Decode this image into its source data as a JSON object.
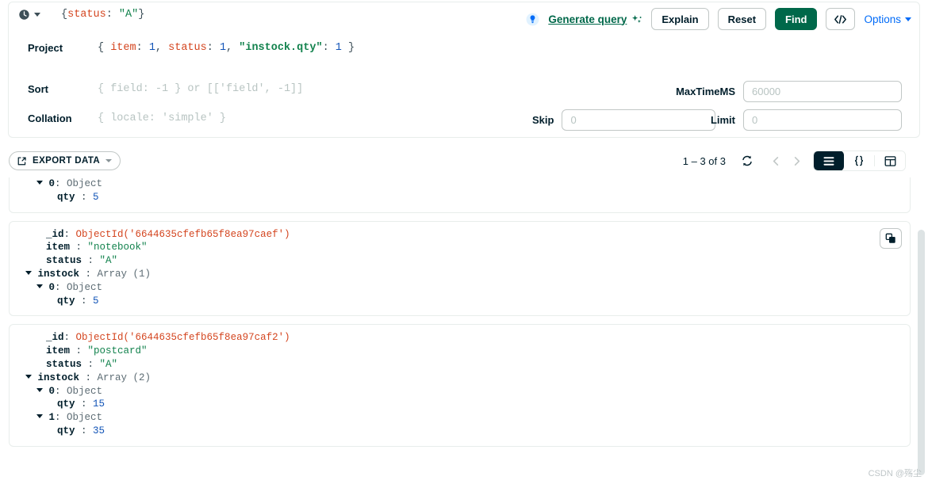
{
  "query_bar": {
    "history_icon": "clock-history-icon",
    "filter": {
      "label": "",
      "segments": [
        {
          "t": "{",
          "c": "punc"
        },
        {
          "t": "status",
          "c": "key"
        },
        {
          "t": ": ",
          "c": "punc"
        },
        {
          "t": "\"A\"",
          "c": "str"
        },
        {
          "t": "}",
          "c": "punc"
        }
      ]
    },
    "project": {
      "label": "Project",
      "segments": [
        {
          "t": "{ ",
          "c": "punc"
        },
        {
          "t": "item",
          "c": "key"
        },
        {
          "t": ": ",
          "c": "punc"
        },
        {
          "t": "1",
          "c": "num"
        },
        {
          "t": ", ",
          "c": "punc"
        },
        {
          "t": "status",
          "c": "key"
        },
        {
          "t": ": ",
          "c": "punc"
        },
        {
          "t": "1",
          "c": "num"
        },
        {
          "t": ", ",
          "c": "punc"
        },
        {
          "t": "\"instock.qty\"",
          "c": "strkey"
        },
        {
          "t": ": ",
          "c": "punc"
        },
        {
          "t": "1",
          "c": "num"
        },
        {
          "t": " }",
          "c": "punc"
        }
      ]
    },
    "sort": {
      "label": "Sort",
      "placeholder": "{ field: -1 } or [['field', -1]]"
    },
    "collation": {
      "label": "Collation",
      "placeholder": "{ locale: 'simple' }"
    },
    "maxtimems": {
      "label": "MaxTimeMS",
      "value": "",
      "placeholder": "60000"
    },
    "skip": {
      "label": "Skip",
      "value": "",
      "placeholder": "0"
    },
    "limit": {
      "label": "Limit",
      "value": "",
      "placeholder": "0"
    },
    "actions": {
      "generate_query": "Generate query",
      "sparkle_icon": "sparkle-icon",
      "lightbulb_icon": "lightbulb-icon",
      "explain": "Explain",
      "reset": "Reset",
      "find": "Find",
      "export_code_icon": "code-brackets-icon",
      "options": "Options"
    }
  },
  "colors": {
    "brand_green": "#00684A",
    "link_blue": "#016BF8",
    "string_green": "#12824D",
    "key_red": "#D4451F",
    "number_blue": "#1254B7",
    "dark": "#001E2B"
  },
  "result_toolbar": {
    "export_label": "EXPORT DATA",
    "export_icon": "export-share-icon",
    "page_range": "1 – 3 of 3",
    "refresh_icon": "refresh-icon",
    "prev_icon": "chevron-left-icon",
    "next_icon": "chevron-right-icon",
    "views": [
      {
        "name": "list-view",
        "icon": "list-icon",
        "active": true
      },
      {
        "name": "json-view",
        "icon": "curly-braces-icon",
        "active": false
      },
      {
        "name": "table-view",
        "icon": "table-grid-icon",
        "active": false
      }
    ]
  },
  "documents": [
    {
      "clipped": true,
      "lines": [
        {
          "indent": 1,
          "caret": true,
          "key": "0",
          "colon": ": ",
          "value": "Object",
          "vtype": "type"
        },
        {
          "indent": 2,
          "caret": false,
          "key": "qty",
          "colon": " : ",
          "value": "5",
          "vtype": "num"
        }
      ]
    },
    {
      "clipped": false,
      "copy_icon": "copy-documents-icon",
      "lines": [
        {
          "indent": 1,
          "caret": false,
          "key": "_id",
          "colon": ": ",
          "value": "ObjectId('6644635cfefb65f8ea97caef')",
          "vtype": "oid"
        },
        {
          "indent": 1,
          "caret": false,
          "key": "item",
          "colon": " : ",
          "value": "\"notebook\"",
          "vtype": "str"
        },
        {
          "indent": 1,
          "caret": false,
          "key": "status",
          "colon": " : ",
          "value": "\"A\"",
          "vtype": "str"
        },
        {
          "indent": 0,
          "caret": true,
          "key": "instock",
          "colon": " : ",
          "value": "Array (1)",
          "vtype": "type"
        },
        {
          "indent": 1,
          "caret": true,
          "key": "0",
          "colon": ": ",
          "value": "Object",
          "vtype": "type"
        },
        {
          "indent": 2,
          "caret": false,
          "key": "qty",
          "colon": " : ",
          "value": "5",
          "vtype": "num"
        }
      ]
    },
    {
      "clipped": false,
      "lines": [
        {
          "indent": 1,
          "caret": false,
          "key": "_id",
          "colon": ": ",
          "value": "ObjectId('6644635cfefb65f8ea97caf2')",
          "vtype": "oid"
        },
        {
          "indent": 1,
          "caret": false,
          "key": "item",
          "colon": " : ",
          "value": "\"postcard\"",
          "vtype": "str"
        },
        {
          "indent": 1,
          "caret": false,
          "key": "status",
          "colon": " : ",
          "value": "\"A\"",
          "vtype": "str"
        },
        {
          "indent": 0,
          "caret": true,
          "key": "instock",
          "colon": " : ",
          "value": "Array (2)",
          "vtype": "type"
        },
        {
          "indent": 1,
          "caret": true,
          "key": "0",
          "colon": ": ",
          "value": "Object",
          "vtype": "type"
        },
        {
          "indent": 2,
          "caret": false,
          "key": "qty",
          "colon": " : ",
          "value": "15",
          "vtype": "num"
        },
        {
          "indent": 1,
          "caret": true,
          "key": "1",
          "colon": ": ",
          "value": "Object",
          "vtype": "type"
        },
        {
          "indent": 2,
          "caret": false,
          "key": "qty",
          "colon": " : ",
          "value": "35",
          "vtype": "num"
        }
      ]
    }
  ],
  "watermark": "CSDN @殇尘"
}
